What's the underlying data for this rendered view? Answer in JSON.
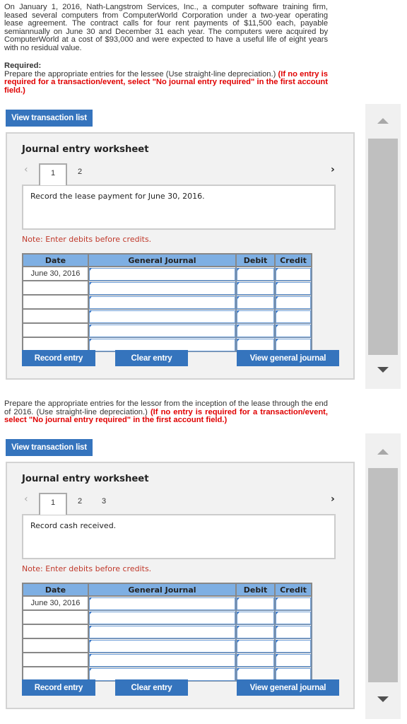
{
  "problem": {
    "text": "On January 1, 2016, Nath-Langstrom Services, Inc., a computer software training firm, leased several computers from ComputerWorld Corporation under a two-year operating lease agreement. The contract calls for four rent payments of $11,500 each, payable semiannually on June 30 and December 31 each year. The computers were acquired by ComputerWorld at a cost of $93,000 and were expected to have a useful life of eight years with no residual value.",
    "required_label": "Required:",
    "lessee_instruction": "Prepare the appropriate entries for the lessee (Use straight-line depreciation.) ",
    "lessee_note": "(If no entry is required for a transaction/event, select \"No journal entry required\" in the first account field.)",
    "lessor_instruction": "Prepare the appropriate entries for the lessor from the inception of the lease through the end of 2016. (Use straight-line depreciation.) ",
    "lessor_note": "(If no entry is required for a transaction/event, select \"No journal entry required\" in the first account field.)"
  },
  "worksheets": [
    {
      "view_transaction_list": "View transaction list",
      "title": "Journal entry worksheet",
      "prev_icon": "‹",
      "next_icon": "›",
      "tabs": [
        "1",
        "2"
      ],
      "active_tab": "1",
      "description": "Record the lease payment for June 30, 2016.",
      "note": "Note: Enter debits before credits.",
      "columns": [
        "Date",
        "General Journal",
        "Debit",
        "Credit"
      ],
      "rows": [
        {
          "date": "June 30, 2016",
          "account": "",
          "debit": "",
          "credit": ""
        },
        {
          "date": "",
          "account": "",
          "debit": "",
          "credit": ""
        },
        {
          "date": "",
          "account": "",
          "debit": "",
          "credit": ""
        },
        {
          "date": "",
          "account": "",
          "debit": "",
          "credit": ""
        },
        {
          "date": "",
          "account": "",
          "debit": "",
          "credit": ""
        },
        {
          "date": "",
          "account": "",
          "debit": "",
          "credit": ""
        }
      ],
      "buttons": {
        "record": "Record entry",
        "clear": "Clear entry",
        "view_journal": "View general journal"
      }
    },
    {
      "view_transaction_list": "View transaction list",
      "title": "Journal entry worksheet",
      "prev_icon": "‹",
      "next_icon": "›",
      "tabs": [
        "1",
        "2",
        "3"
      ],
      "active_tab": "1",
      "description": "Record cash received.",
      "note": "Note: Enter debits before credits.",
      "columns": [
        "Date",
        "General Journal",
        "Debit",
        "Credit"
      ],
      "rows": [
        {
          "date": "June 30, 2016",
          "account": "",
          "debit": "",
          "credit": ""
        },
        {
          "date": "",
          "account": "",
          "debit": "",
          "credit": ""
        },
        {
          "date": "",
          "account": "",
          "debit": "",
          "credit": ""
        },
        {
          "date": "",
          "account": "",
          "debit": "",
          "credit": ""
        },
        {
          "date": "",
          "account": "",
          "debit": "",
          "credit": ""
        },
        {
          "date": "",
          "account": "",
          "debit": "",
          "credit": ""
        }
      ],
      "buttons": {
        "record": "Record entry",
        "clear": "Clear entry",
        "view_journal": "View general journal"
      }
    }
  ],
  "colors": {
    "button": "#3574bd",
    "table_header": "#7eafe3",
    "note_red": "#c0392b",
    "instruction_red": "#e00000"
  }
}
